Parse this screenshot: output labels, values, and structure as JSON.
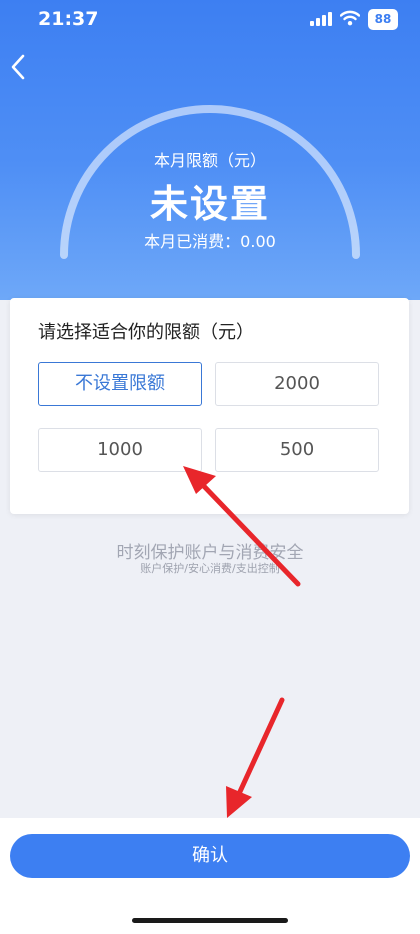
{
  "status_bar": {
    "time": "21:37",
    "battery": "88"
  },
  "header": {
    "limit_label": "本月限额（元）",
    "limit_value": "未设置",
    "spent_text": "本月已消费：0.00"
  },
  "card": {
    "title": "请选择适合你的限额（元）",
    "options": [
      {
        "label": "不设置限额",
        "selected": true
      },
      {
        "label": "2000",
        "selected": false
      },
      {
        "label": "1000",
        "selected": false
      },
      {
        "label": "500",
        "selected": false
      }
    ]
  },
  "slogan": {
    "main": "时刻保护账户与消费安全",
    "sub": "账户保护/安心消费/支出控制"
  },
  "confirm_label": "确认",
  "colors": {
    "primary": "#3d7ff2",
    "selected_border": "#3a78d6",
    "annotation_arrow": "#e8262b"
  }
}
